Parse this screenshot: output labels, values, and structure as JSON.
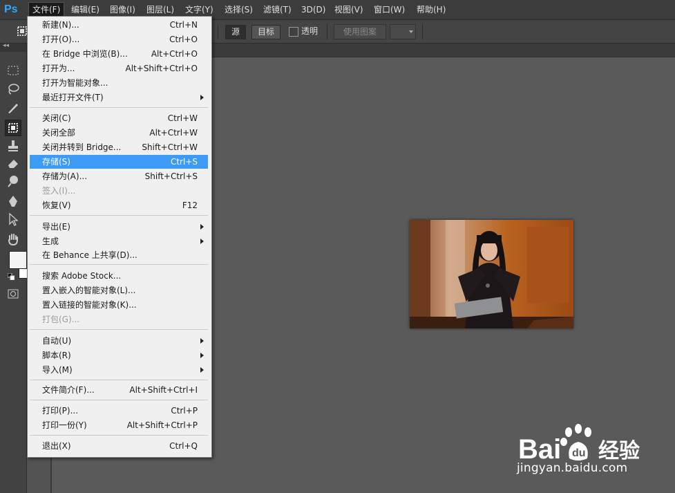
{
  "app": {
    "logo": "Ps"
  },
  "menubar": {
    "items": [
      {
        "label": "文件(F)"
      },
      {
        "label": "编辑(E)"
      },
      {
        "label": "图像(I)"
      },
      {
        "label": "图层(L)"
      },
      {
        "label": "文字(Y)"
      },
      {
        "label": "选择(S)"
      },
      {
        "label": "滤镜(T)"
      },
      {
        "label": "3D(D)"
      },
      {
        "label": "视图(V)"
      },
      {
        "label": "窗口(W)"
      },
      {
        "label": "帮助(H)"
      }
    ],
    "active_index": 0
  },
  "options": {
    "source_label": "源",
    "target_label": "目标",
    "transparent_label": "透明",
    "transparent_checked": false,
    "use_pattern_label": "使用图案"
  },
  "file_menu": {
    "items": [
      {
        "label": "新建(N)...",
        "shortcut": "Ctrl+N"
      },
      {
        "label": "打开(O)...",
        "shortcut": "Ctrl+O"
      },
      {
        "label": "在 Bridge 中浏览(B)...",
        "shortcut": "Alt+Ctrl+O"
      },
      {
        "label": "打开为...",
        "shortcut": "Alt+Shift+Ctrl+O"
      },
      {
        "label": "打开为智能对象...",
        "shortcut": ""
      },
      {
        "label": "最近打开文件(T)",
        "shortcut": "",
        "submenu": true
      },
      {
        "label": "关闭(C)",
        "shortcut": "Ctrl+W"
      },
      {
        "label": "关闭全部",
        "shortcut": "Alt+Ctrl+W"
      },
      {
        "label": "关闭并转到 Bridge...",
        "shortcut": "Shift+Ctrl+W"
      },
      {
        "label": "存储(S)",
        "shortcut": "Ctrl+S",
        "highlighted": true
      },
      {
        "label": "存储为(A)...",
        "shortcut": "Shift+Ctrl+S"
      },
      {
        "label": "签入(I)...",
        "shortcut": "",
        "disabled": true
      },
      {
        "label": "恢复(V)",
        "shortcut": "F12"
      },
      {
        "label": "导出(E)",
        "shortcut": "",
        "submenu": true
      },
      {
        "label": "生成",
        "shortcut": "",
        "submenu": true
      },
      {
        "label": "在 Behance 上共享(D)...",
        "shortcut": ""
      },
      {
        "label": "搜索 Adobe Stock...",
        "shortcut": ""
      },
      {
        "label": "置入嵌入的智能对象(L)...",
        "shortcut": ""
      },
      {
        "label": "置入链接的智能对象(K)...",
        "shortcut": ""
      },
      {
        "label": "打包(G)...",
        "shortcut": "",
        "disabled": true
      },
      {
        "label": "自动(U)",
        "shortcut": "",
        "submenu": true
      },
      {
        "label": "脚本(R)",
        "shortcut": "",
        "submenu": true
      },
      {
        "label": "导入(M)",
        "shortcut": "",
        "submenu": true
      },
      {
        "label": "文件简介(F)...",
        "shortcut": "Alt+Shift+Ctrl+I"
      },
      {
        "label": "打印(P)...",
        "shortcut": "Ctrl+P"
      },
      {
        "label": "打印一份(Y)",
        "shortcut": "Alt+Shift+Ctrl+P"
      },
      {
        "label": "退出(X)",
        "shortcut": "Ctrl+Q"
      }
    ]
  },
  "watermark": {
    "brand": "Bai",
    "brand2": "经验",
    "url": "jingyan.baidu.com"
  }
}
